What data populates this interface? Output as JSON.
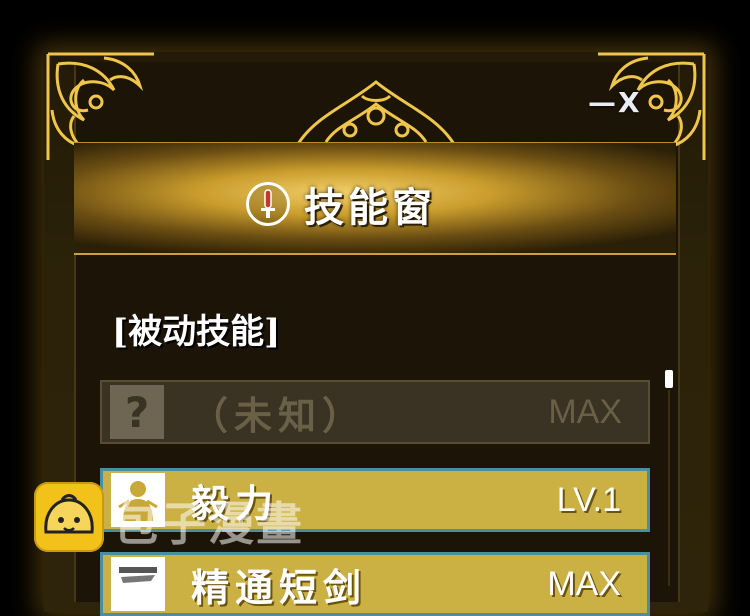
{
  "window": {
    "title": "技能窗",
    "minimize_label": "—",
    "close_label": "X"
  },
  "section_heading": "[被动技能]",
  "skills": [
    {
      "icon": "question-icon",
      "icon_glyph": "?",
      "name": "（未知）",
      "level": "MAX",
      "state": "locked"
    },
    {
      "icon": "strength-figure-icon",
      "name": "毅力",
      "level": "LV.1",
      "state": "active"
    },
    {
      "icon": "sword-scroll-icon",
      "name": "精通短剑",
      "level": "MAX",
      "state": "active"
    }
  ],
  "watermark": {
    "text": "包子漫畫"
  },
  "colors": {
    "gold": "#caa043",
    "active_row": "#cbb043",
    "active_border": "#4a8fa0",
    "locked_row": "#3a3222"
  }
}
